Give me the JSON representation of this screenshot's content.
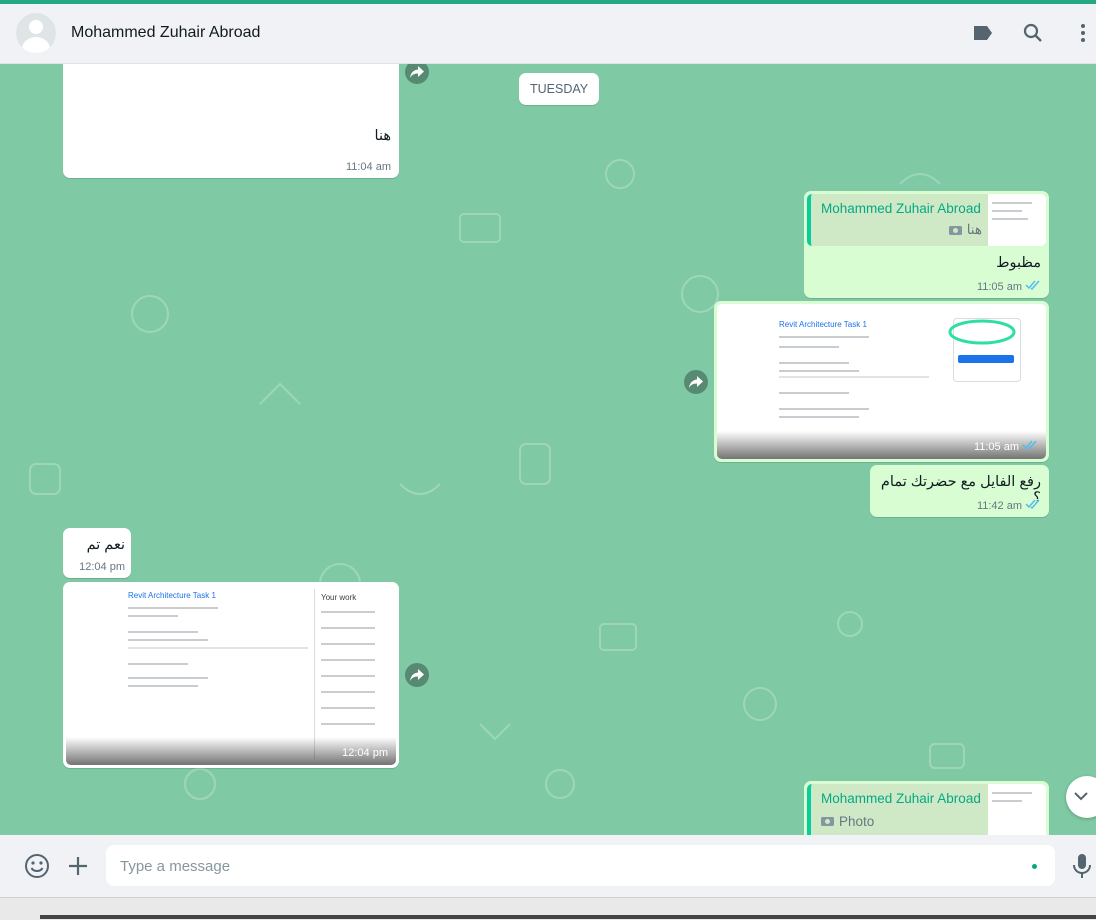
{
  "header": {
    "contact_name": "Mohammed Zuhair Abroad"
  },
  "chat": {
    "date_label": "TUESDAY",
    "messages": [
      {
        "text": "هنا",
        "time": "11:04 am"
      },
      {
        "quote_name": "Mohammed Zuhair Abroad",
        "quote_text": "هنا",
        "text": "مظبوط",
        "time": "11:05 am"
      },
      {
        "image_title": "Revit Architecture Task 1",
        "time": "11:05 am"
      },
      {
        "text": "رفع الفايل مع حضرتك تمام ؟",
        "time": "11:42 am"
      },
      {
        "text": "نعم تم",
        "time": "12:04 pm"
      },
      {
        "image_title": "Revit Architecture Task 1",
        "image_side": "Your work",
        "time": "12:04 pm"
      },
      {
        "quote_name": "Mohammed Zuhair Abroad",
        "quote_text": "Photo"
      }
    ]
  },
  "composer": {
    "placeholder": "Type a message"
  },
  "colors": {
    "accent": "#25a884",
    "wallpaper": "#7fc9a4",
    "outgoing": "#d9fdd3",
    "tick": "#53bdeb"
  },
  "icons": [
    "label-icon",
    "search-icon",
    "menu-icon",
    "forward-icon",
    "read-ticks-icon",
    "camera-icon",
    "emoji-icon",
    "plus-icon",
    "microphone-icon",
    "chevron-down-icon"
  ]
}
